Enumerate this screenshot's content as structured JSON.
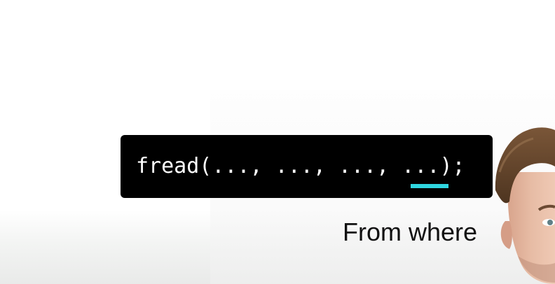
{
  "code": {
    "prefix": "fread(..., ..., ..., ",
    "highlighted": "...",
    "suffix": ");"
  },
  "caption": "From where",
  "colors": {
    "code_background": "#000000",
    "code_text": "#ffffff",
    "highlight_underline": "#2fd6e0",
    "caption_text": "#111111"
  },
  "presenter": {
    "icon": "presenter-face"
  }
}
